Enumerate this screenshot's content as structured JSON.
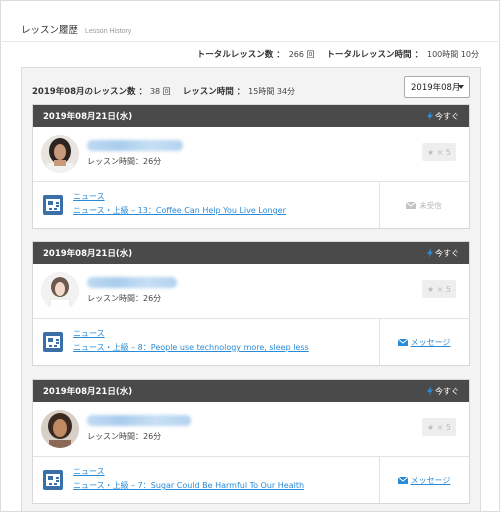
{
  "header": {
    "title": "レッスン履歴",
    "subtitle": "Lesson History"
  },
  "totals": {
    "count_label": "トータルレッスン数 ：",
    "count_value": "266 回",
    "time_label": "トータルレッスン時間 ：",
    "time_value": "100時間 10分"
  },
  "month_summary": {
    "count_label": "2019年08月のレッスン数 ：",
    "count_value": "38 回",
    "time_label": "レッスン時間 ：",
    "time_value": "15時間 34分",
    "selected_month": "2019年08月"
  },
  "lessons": [
    {
      "date": "2019年08月21日(水)",
      "now_label": "今すぐ",
      "duration": "レッスン時間：26分",
      "favorite": "★ × 5",
      "category": "ニュース",
      "title": "ニュース・上級 – 13：Coffee Can Help You Live Longer",
      "message": "未受信",
      "message_state": "unread"
    },
    {
      "date": "2019年08月21日(水)",
      "now_label": "今すぐ",
      "duration": "レッスン時間：26分",
      "favorite": "★ × 5",
      "category": "ニュース",
      "title": "ニュース・上級 – 8：People use technology more, sleep less",
      "message": "メッセージ",
      "message_state": "link"
    },
    {
      "date": "2019年08月21日(水)",
      "now_label": "今すぐ",
      "duration": "レッスン時間：26分",
      "favorite": "★ × 5",
      "category": "ニュース",
      "title": "ニュース・上級 – 7：Sugar Could Be Harmful To Our Health",
      "message": "メッセージ",
      "message_state": "link"
    }
  ],
  "colors": {
    "card_header": "#4a4a4a",
    "link": "#2a8bd6",
    "bolt": "#2a8bd6",
    "icon_blue": "#3b6fa8"
  }
}
